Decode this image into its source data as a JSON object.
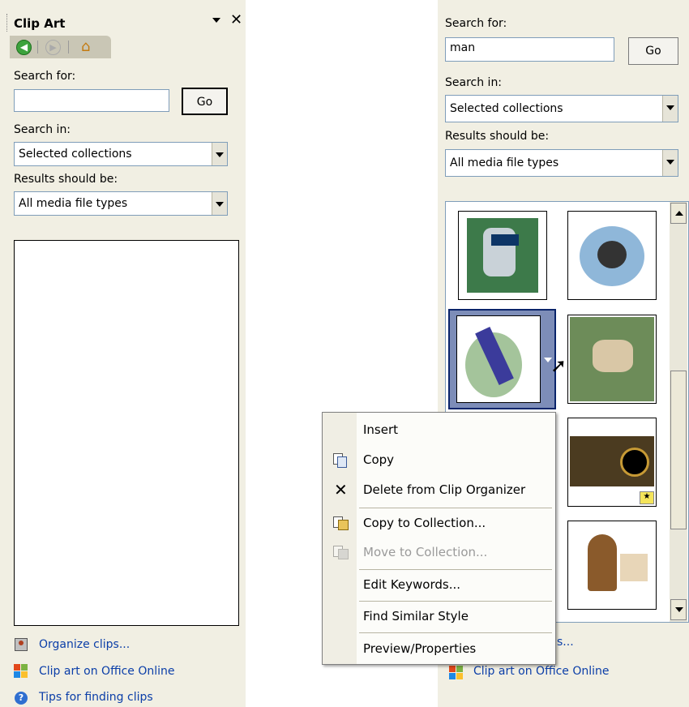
{
  "left_pane": {
    "title": "Clip Art",
    "search_for_label": "Search for:",
    "search_value": "",
    "go_label": "Go",
    "search_in_label": "Search in:",
    "search_in_value": "Selected collections",
    "results_label": "Results should be:",
    "results_value": "All media file types",
    "footer_links": [
      "Organize clips...",
      "Clip art on Office Online",
      "Tips for finding clips"
    ]
  },
  "right_pane": {
    "search_for_label": "Search for:",
    "search_value": "man",
    "go_label": "Go",
    "search_in_label": "Search in:",
    "search_in_value": "Selected collections",
    "results_label": "Results should be:",
    "results_value": "All media file types",
    "footer_link_partial": "s...",
    "footer_link_2": "Clip art on Office Online"
  },
  "context_menu": {
    "items": [
      {
        "label": "Insert",
        "icon": "none",
        "disabled": false
      },
      {
        "label": "Copy",
        "icon": "copy-icon",
        "disabled": false
      },
      {
        "label": "Delete from Clip Organizer",
        "icon": "delete-x-icon",
        "disabled": false
      },
      {
        "label": "Copy to Collection...",
        "icon": "copy-to-collection-icon",
        "disabled": false
      },
      {
        "label": "Move to Collection...",
        "icon": "move-to-collection-icon",
        "disabled": true
      },
      {
        "label": "Edit Keywords...",
        "icon": "none",
        "disabled": false
      },
      {
        "label": "Find Similar Style",
        "icon": "none",
        "disabled": false
      },
      {
        "label": "Preview/Properties",
        "icon": "none",
        "disabled": false
      }
    ]
  },
  "colors": {
    "pane_bg": "#f1efe3",
    "link": "#0b3ea8",
    "selection_border": "#0a246a",
    "selection_fill": "#7d8db8"
  }
}
